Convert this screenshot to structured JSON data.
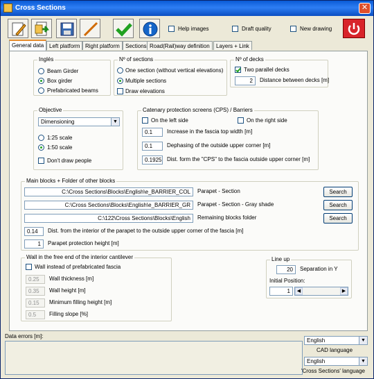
{
  "window": {
    "title": "Cross Sections",
    "close_icon": "✕"
  },
  "toolbar": {
    "icons": [
      "pencil-icon",
      "page-arrow-icon",
      "save-icon",
      "line-icon",
      "checkmark-icon",
      "info-icon",
      "power-icon"
    ],
    "help_images_label": "Help images",
    "draft_quality_label": "Draft quality",
    "new_drawing_label": "New drawing"
  },
  "tabs": [
    "General data",
    "Left platform",
    "Right platform",
    "Sections",
    "Road(Rail)way definition",
    "Layers + Link"
  ],
  "ingles": {
    "title": "Inglés",
    "options": [
      "Beam Girder",
      "Box girder",
      "Prefabricated beams"
    ],
    "selected": 1
  },
  "sections": {
    "title": "Nº of sections",
    "options": [
      "One section (without vertical elevations)",
      "Multiple sections"
    ],
    "selected": 1,
    "draw_elevations_label": "Draw elevations"
  },
  "decks": {
    "title": "Nº of decks",
    "two_parallel_label": "Two parallel decks",
    "distance_value": "2",
    "distance_label": "Distance between decks [m]"
  },
  "objective": {
    "title": "Objective",
    "select_value": "Dimensioning",
    "scale_options": [
      "1:25 scale",
      "1:50 scale"
    ],
    "scale_selected": 1,
    "dont_draw_label": "Don't draw people"
  },
  "cps": {
    "title": "Catenary protection screens (CPS) / Barriers",
    "left_label": "On the left side",
    "right_label": "On the right side",
    "rows": [
      {
        "value": "0.1",
        "label": "Increase in the fascia top width [m]"
      },
      {
        "value": "0.1",
        "label": "Dephasing of the outside upper corner [m]"
      },
      {
        "value": "0.1925",
        "label": "Dist. form the \"CPS\" to the fascia outside upper corner [m]"
      }
    ]
  },
  "blocks": {
    "title": "Main blocks + Folder of other blocks",
    "rows": [
      {
        "path": "C:\\Cross Sections\\Blocks\\English\\e_BARRIER_COL",
        "label": "Parapet - Section",
        "button": "Search"
      },
      {
        "path": "C:\\Cross Sections\\Blocks\\English\\e_BARRIER_GR",
        "label": "Parapet - Section - Gray shade",
        "button": "Search"
      },
      {
        "path": "C:\\122\\Cross Sections\\Blocks\\English",
        "label": "Remaining blocks folder",
        "button": "Search"
      }
    ],
    "dist_value": "0.14",
    "dist_label": "Dist. from the interior of the parapet to the outside upper corner of the fascia [m]",
    "height_value": "1",
    "height_label": "Parapet protection height [m]"
  },
  "wall": {
    "title": "Wall in the free end of the interior cantilever",
    "instead_label": "Wall instead of prefabricated fascia",
    "rows": [
      {
        "value": "0.25",
        "label": "Wall thickness [m]"
      },
      {
        "value": "0.35",
        "label": "Wall height [m]"
      },
      {
        "value": "0.15",
        "label": "Minimum filling height [m]"
      },
      {
        "value": "0.5",
        "label": "Filling slope [%]"
      }
    ]
  },
  "lineup": {
    "title": "Line up",
    "separation_value": "20",
    "separation_label": "Separation in Y",
    "initial_label": "Initial Position:",
    "initial_value": "1"
  },
  "bottom": {
    "errors_label": "Data errors [m]:",
    "cad_language_value": "English",
    "cad_language_label": "CAD language",
    "cs_language_value": "English",
    "cs_language_label": "'Cross Sections' language"
  },
  "colors": {
    "titlebar": "#0a5bd6",
    "check_mark": "#21a121",
    "power_button": "#d8242a",
    "tab_accent": "#e68b2c"
  }
}
